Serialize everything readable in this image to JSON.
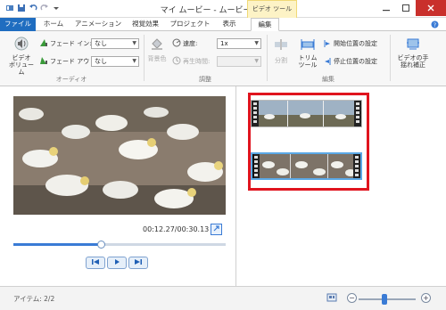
{
  "window": {
    "title": "マイ ムービー - ムービー メーカー",
    "contextual_tab": "ビデオ ツール"
  },
  "tabs": [
    "ファイル",
    "ホーム",
    "アニメーション",
    "視覚効果",
    "プロジェクト",
    "表示",
    "編集"
  ],
  "ribbon": {
    "audio": {
      "video_volume_label": "ビデオ\nボリューム",
      "fade_in_label": "フェード イン:",
      "fade_in_value": "なし",
      "fade_out_label": "フェード アウト:",
      "fade_out_value": "なし",
      "group_label": "オーディオ"
    },
    "adjust": {
      "bg_color_label": "背景色",
      "speed_label": "速度:",
      "speed_value": "1x",
      "duration_label": "再生時間:",
      "duration_value": "",
      "group_label": "調整"
    },
    "edit": {
      "split_label": "分割",
      "trim_tool_label": "トリム\nツール",
      "set_start_label": "開始位置の設定",
      "set_end_label": "停止位置の設定",
      "group_label": "編集"
    },
    "stabilize": {
      "label": "ビデオの手\n揺れ補正"
    }
  },
  "preview": {
    "timecode": "00:12.27/00:30.13",
    "progress_fraction": 0.41
  },
  "status": {
    "items_label": "アイテム: 2/2"
  },
  "zoom": {
    "minus": "−",
    "plus": "+",
    "level_fraction": 0.45
  },
  "colors": {
    "file_tab": "#1f6dc0",
    "accent": "#3a7bd5",
    "highlight_border": "#e0141e",
    "close_button": "#c9302c"
  }
}
